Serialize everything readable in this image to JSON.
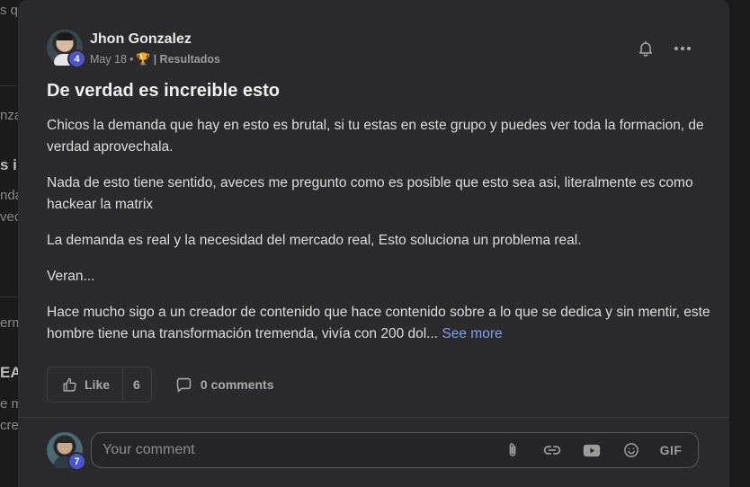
{
  "background_feed": {
    "snippets": [
      "s q",
      "nza",
      "s ir",
      "nda",
      "vec",
      "erm",
      "EA",
      "e m",
      "cre"
    ]
  },
  "post": {
    "author": {
      "name": "Jhon Gonzalez",
      "level": "4"
    },
    "date": "May 18",
    "separator": "•",
    "category": "| Resultados",
    "title": "De verdad es increible esto",
    "paragraphs": [
      "Chicos la demanda que hay en esto es brutal, si tu estas en este grupo y puedes ver toda la formacion, de verdad aprovechala.",
      "Nada de esto tiene sentido, aveces me pregunto como es posible que esto sea asi, literalmente es como hackear la matrix",
      "La demanda es real y la necesidad del mercado real, Esto soluciona un problema real.",
      "Veran...",
      "Hace mucho sigo a un creador de contenido que hace contenido sobre a lo que se dedica y sin mentir, este hombre tiene una transformación tremenda, vivía con 200 dol..."
    ],
    "see_more": "See more",
    "like_label": "Like",
    "like_count": "6",
    "comments_label": "0 comments"
  },
  "comment_box": {
    "placeholder": "Your comment",
    "user_level": "7",
    "gif_label": "GIF"
  },
  "icons": {
    "bell": "bell-icon",
    "more": "more-horizontal-icon",
    "like": "thumbs-up-icon",
    "comment": "comment-bubble-icon",
    "attach": "paperclip-icon",
    "link": "link-icon",
    "video": "youtube-icon",
    "emoji": "smiley-icon",
    "trophy": "trophy-icon"
  },
  "colors": {
    "accent_link": "#7aa2e8",
    "level_badge": "#4a56c8",
    "trophy": "#e0a93a"
  }
}
